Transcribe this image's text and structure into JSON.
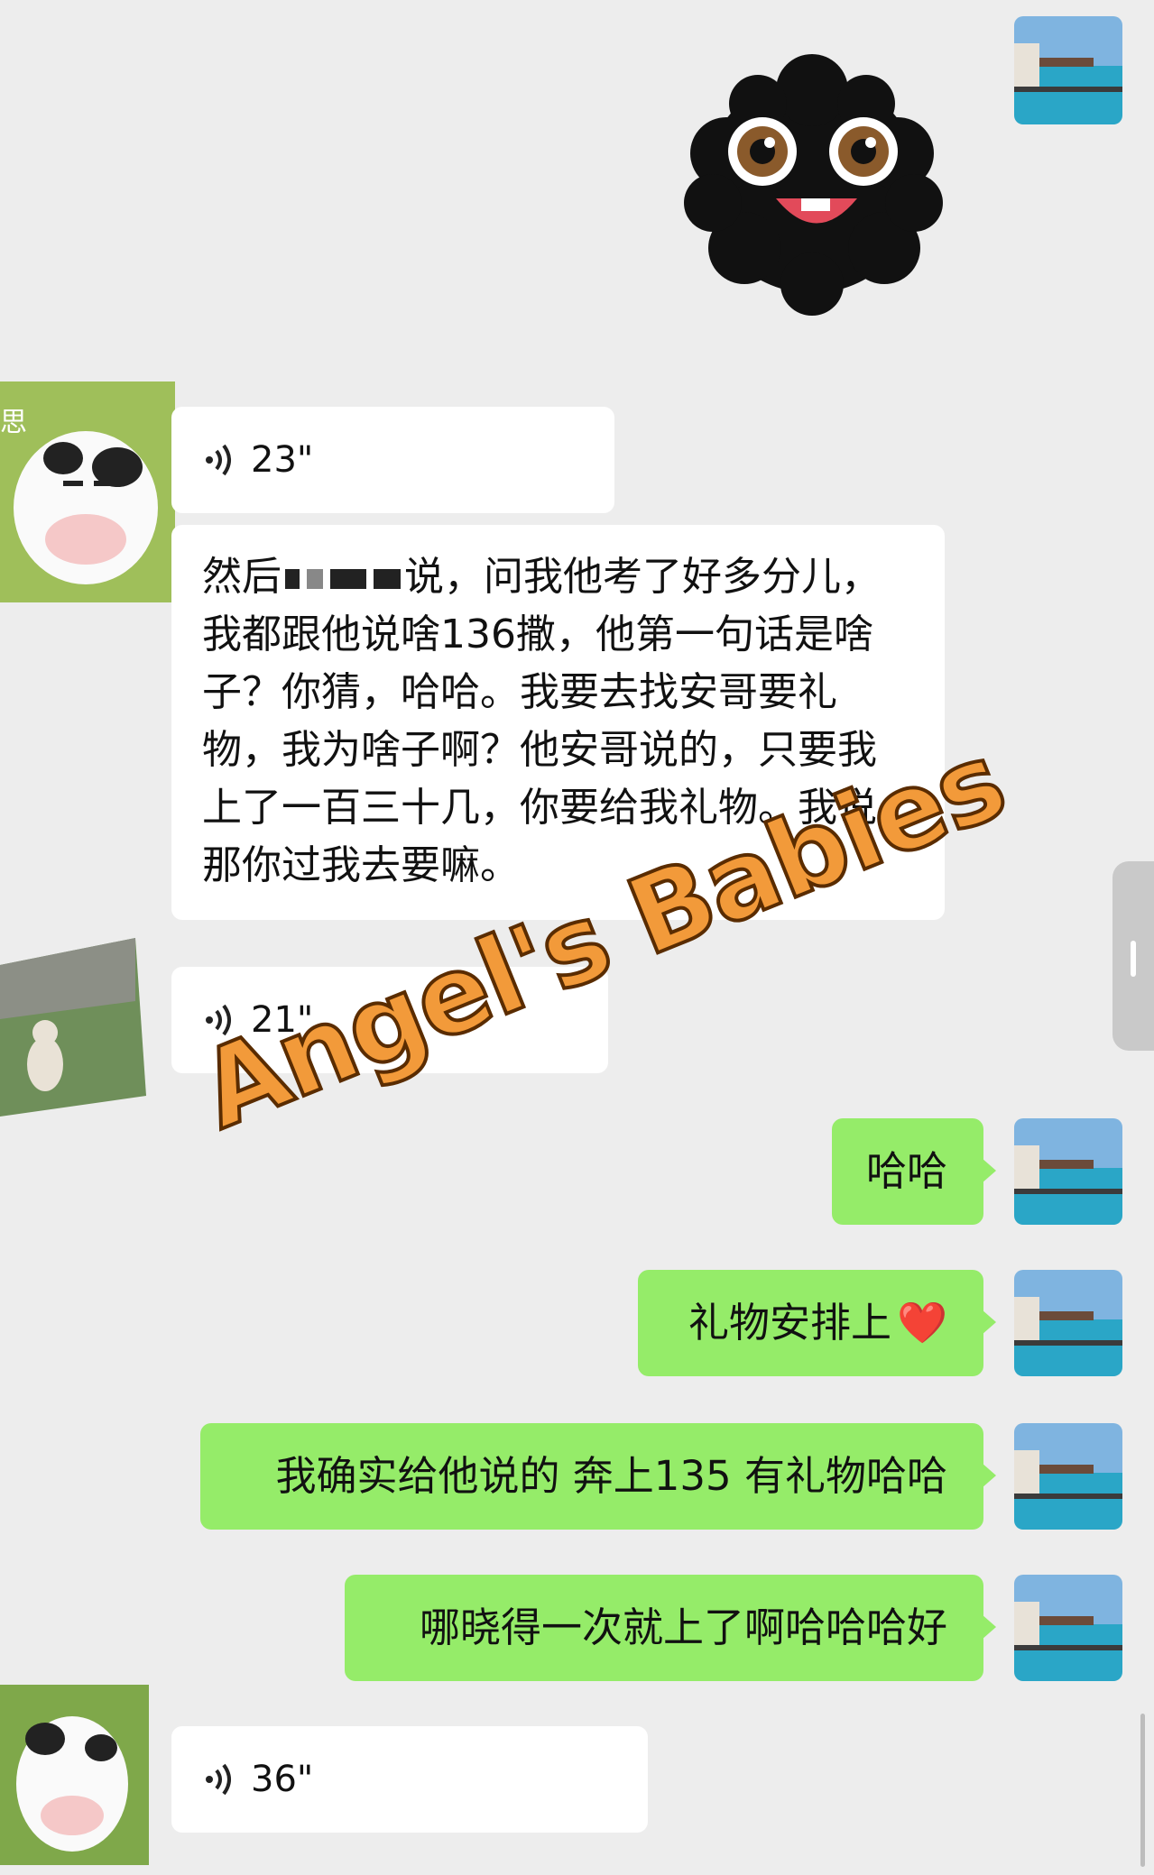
{
  "messages": {
    "voice_1": "23\"",
    "text_1": "然后说，问我他考了好多分儿，我都跟他说啥136撒，他第一句话是啥子？你猜，哈哈。我要去找安哥要礼物，我为啥子啊？他安哥说的，只要我上了一百三十几，你要给我礼物。我说那你过我去要嘛。",
    "text_1_prefix": "然后",
    "text_1_rest": "说，问我他考了好多分儿，我都跟他说啥136撒，他第一句话是啥子？你猜，哈哈。我要去找安哥要礼物，我为啥子啊？他安哥说的，只要我上了一百三十几，你要给我礼物。我说那你过我去要嘛。",
    "voice_2": "21\"",
    "out_1": "哈哈",
    "out_2": "礼物安排上",
    "out_2_emoji": "❤️",
    "out_3": "我确实给他说的 奔上135 有礼物哈哈",
    "out_4": "哪晓得一次就上了啊哈哈哈好",
    "voice_3": "36\""
  },
  "avatar_1_text": "思",
  "watermark": "Angel's Babies",
  "icons": {
    "voice": "voice-wave-icon",
    "heart": "heart-emoji"
  },
  "colors": {
    "background": "#ededed",
    "incoming_bubble": "#ffffff",
    "outgoing_bubble": "#95ec69",
    "watermark": "#f29a3a"
  }
}
